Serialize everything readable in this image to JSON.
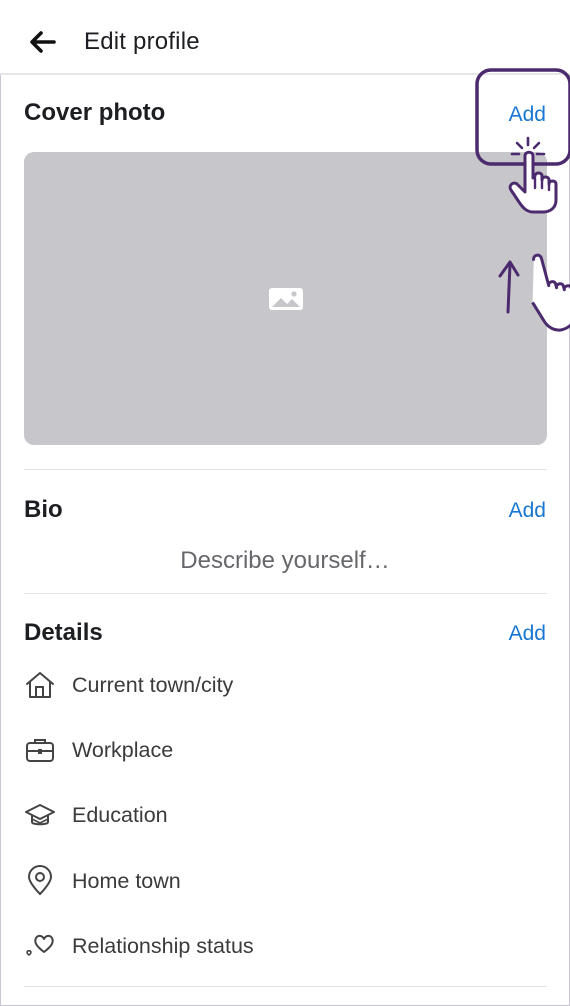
{
  "header": {
    "title": "Edit profile"
  },
  "cover_photo": {
    "title": "Cover photo",
    "add_label": "Add"
  },
  "bio": {
    "title": "Bio",
    "add_label": "Add",
    "placeholder": "Describe yourself…"
  },
  "details": {
    "title": "Details",
    "add_label": "Add",
    "items": [
      {
        "label": "Current town/city",
        "icon": "home-icon"
      },
      {
        "label": "Workplace",
        "icon": "briefcase-icon"
      },
      {
        "label": "Education",
        "icon": "graduation-cap-icon"
      },
      {
        "label": "Home town",
        "icon": "location-pin-icon"
      },
      {
        "label": "Relationship status",
        "icon": "heart-icon"
      }
    ]
  },
  "colors": {
    "link": "#1877d2",
    "annotation": "#4b2a6e",
    "cover_bg": "#c7c6cb"
  }
}
